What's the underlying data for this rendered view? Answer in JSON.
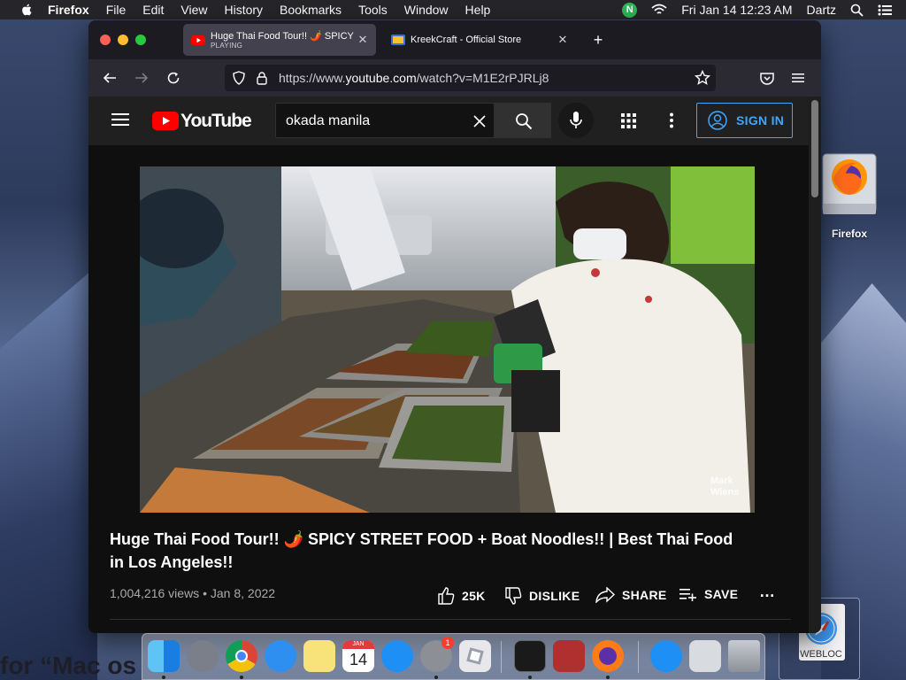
{
  "menubar": {
    "app_name": "Firefox",
    "menus": [
      "File",
      "Edit",
      "View",
      "History",
      "Bookmarks",
      "Tools",
      "Window",
      "Help"
    ],
    "clock": "Fri Jan 14  12:23 AM",
    "user": "Dartz",
    "notif_letter": "N"
  },
  "browser": {
    "tabs": [
      {
        "title": "Huge Thai Food Tour!! 🌶️ SPICY",
        "status": "PLAYING",
        "close": "✕"
      },
      {
        "title": "KreekCraft - Official Store",
        "close": "✕"
      }
    ],
    "new_tab": "+",
    "url_prefix": "https://www.",
    "url_host": "youtube.com",
    "url_path": "/watch?v=M1E2rPJRLj8"
  },
  "youtube": {
    "logo_text": "YouTube",
    "search_query": "okada manila",
    "sign_in": "SIGN IN",
    "video_title": "Huge Thai Food Tour!! 🌶️ SPICY STREET FOOD + Boat Noodles!! | Best Thai Food in Los Angeles!!",
    "views": "1,004,216 views",
    "separator": "•",
    "date": "Jan 8, 2022",
    "likes": "25K",
    "dislike": "DISLIKE",
    "share": "SHARE",
    "save": "SAVE",
    "more": "…",
    "watermark": "Mark Wiens"
  },
  "desktop": {
    "firefox_label": "Firefox",
    "webloc_label": "WEBLOC",
    "partial_text": "for “Mac os"
  },
  "dock": {
    "calendar_month": "JAN",
    "calendar_day": "14",
    "badge": "1"
  },
  "colors": {
    "yt_red": "#ff0000",
    "accent_blue": "#3ea6ff",
    "menubar": "#26262a",
    "browser_chrome": "#2b2a33"
  }
}
